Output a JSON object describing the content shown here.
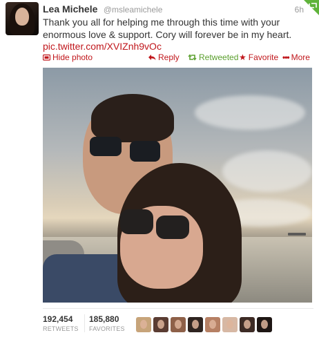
{
  "tweet": {
    "name": "Lea Michele",
    "handle": "@msleamichele",
    "time": "6h",
    "text": "Thank you all for helping me through this time with your enormous love & support. Cory will forever be in my heart.",
    "link": "pic.twitter.com/XVIZnh9vOc"
  },
  "actions": {
    "hide_photo": "Hide photo",
    "reply": "Reply",
    "retweeted": "Retweeted",
    "favorite": "Favorite",
    "more": "More"
  },
  "stats": {
    "retweets_count": "192,454",
    "retweets_label": "RETWEETS",
    "favorites_count": "185,880",
    "favorites_label": "FAVORITES"
  },
  "favoriters": [
    {
      "color": "#c7a47a"
    },
    {
      "color": "#5a3c32"
    },
    {
      "color": "#8e6048"
    },
    {
      "color": "#2f2420"
    },
    {
      "color": "#b68064"
    },
    {
      "color": "#d7b8a4"
    },
    {
      "color": "#3d2b25"
    },
    {
      "color": "#1e1614"
    }
  ],
  "colors": {
    "accent_red": "#c0161b",
    "retweeted_green": "#5a9f2d",
    "muted_gray": "#999999"
  },
  "icons": {
    "hide_photo": "photo-icon",
    "reply": "reply-arrow-icon",
    "retweeted": "retweet-icon",
    "favorite": "star-icon",
    "more": "ellipsis-icon",
    "corner": "retweet-corner-badge-icon"
  }
}
